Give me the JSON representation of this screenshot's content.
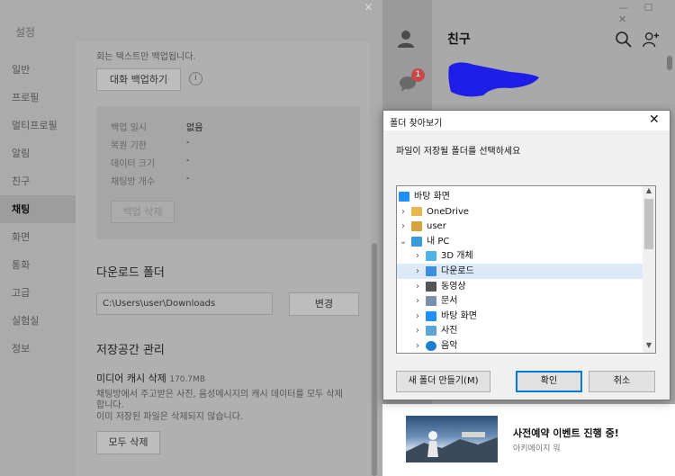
{
  "settings": {
    "close_glyph": "×",
    "title": "설정",
    "sidebar": [
      "일반",
      "프로필",
      "멀티프로필",
      "알림",
      "친구",
      "채팅",
      "화면",
      "통화",
      "고급",
      "실험실",
      "정보"
    ],
    "active_item": "채팅",
    "note_top": "회는 텍스트만 백업됩니다.",
    "backup_button": "대화 백업하기",
    "info_glyph": "i",
    "backup_rows": [
      {
        "label": "백업 일시",
        "value": "없음"
      },
      {
        "label": "복원 기한",
        "value": "-"
      },
      {
        "label": "데이터 크기",
        "value": "-"
      },
      {
        "label": "채팅방 개수",
        "value": "-"
      }
    ],
    "delete_backup_button": "백업 삭제",
    "download_title": "다운로드 폴더",
    "download_path": "C:\\Users\\user\\Downloads",
    "change_button": "변경",
    "storage_title": "저장공간 관리",
    "media_cache_label": "미디어 캐시 삭제",
    "media_cache_size": "170.7MB",
    "cache_desc1": "채팅방에서 주고받은 사진, 음성메시지의 캐시 데이터를 모두 삭제",
    "cache_desc1b": "합니다.",
    "cache_desc2": "이미 저장된 파일은 삭제되지 않습니다.",
    "delete_all_button": "모두 삭제"
  },
  "friends": {
    "title": "친구",
    "window_buttons": "— ☐ ✕",
    "badge": "1",
    "ad_title": "사전예약 이벤트 진행 중!",
    "ad_sub": "아키에이지 워"
  },
  "dialog": {
    "title": "폴더 찾아보기",
    "close_glyph": "✕",
    "instruction": "파일이 저장될 폴더를 선택하세요",
    "tree": [
      {
        "label": "바탕 화면",
        "chev": "",
        "icon": "desktop-icon",
        "color": "#1e90ff"
      },
      {
        "label": "OneDrive",
        "chev": "›",
        "icon": "folder-icon",
        "color": "#e8b64c"
      },
      {
        "label": "user",
        "chev": "›",
        "icon": "user-icon",
        "color": "#d8a23a"
      },
      {
        "label": "내 PC",
        "chev": "⌄",
        "icon": "pc-icon",
        "color": "#3a9ad9"
      },
      {
        "label": "3D 개체",
        "chev": "›",
        "icon": "cube-icon",
        "color": "#4fb3e8"
      },
      {
        "label": "다운로드",
        "chev": "›",
        "icon": "download-icon",
        "color": "#3a8ee0"
      },
      {
        "label": "동영상",
        "chev": "›",
        "icon": "video-icon",
        "color": "#555555"
      },
      {
        "label": "문서",
        "chev": "›",
        "icon": "document-icon",
        "color": "#7a8fa8"
      },
      {
        "label": "바탕 화면",
        "chev": "›",
        "icon": "desktop-icon",
        "color": "#1e90ff"
      },
      {
        "label": "사진",
        "chev": "›",
        "icon": "picture-icon",
        "color": "#5ba5d8"
      },
      {
        "label": "음악",
        "chev": "›",
        "icon": "music-icon",
        "color": "#1e7fd0"
      }
    ],
    "selected_index": 5,
    "new_folder_button": "새 폴더 만들기(M)",
    "ok_button": "확인",
    "cancel_button": "취소"
  }
}
